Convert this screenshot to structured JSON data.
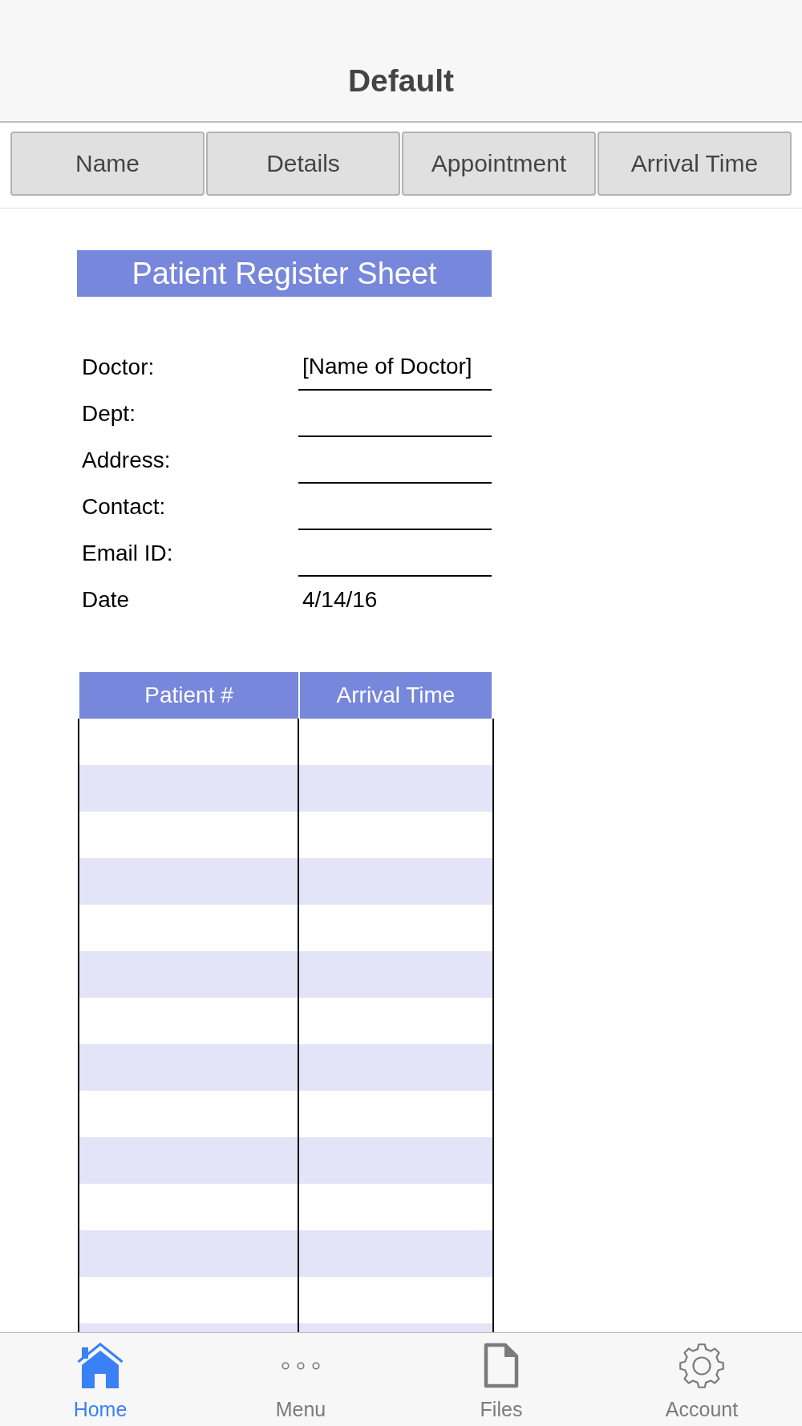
{
  "header": {
    "title": "Default"
  },
  "segments": [
    {
      "label": "Name",
      "selected": false
    },
    {
      "label": "Details",
      "selected": false
    },
    {
      "label": "Appointment",
      "selected": false
    },
    {
      "label": "Arrival Time",
      "selected": false
    }
  ],
  "sheet": {
    "title": "Patient Register Sheet",
    "fields": [
      {
        "label": "Doctor:",
        "kind": "line",
        "value": "[Name of Doctor]"
      },
      {
        "label": "Dept:",
        "kind": "line"
      },
      {
        "label": "Address:",
        "kind": "line"
      },
      {
        "label": "Contact:",
        "kind": "line"
      },
      {
        "label": "Email ID:",
        "kind": "line"
      },
      {
        "label": "Date",
        "kind": "plain",
        "value": "4/14/16"
      }
    ],
    "table": {
      "columns": [
        "Patient #",
        "Arrival Time"
      ],
      "rows": [
        {
          "shaded": false
        },
        {
          "shaded": true
        },
        {
          "shaded": false
        },
        {
          "shaded": true
        },
        {
          "shaded": false
        },
        {
          "shaded": true
        },
        {
          "shaded": false
        },
        {
          "shaded": true
        },
        {
          "shaded": false
        },
        {
          "shaded": true
        },
        {
          "shaded": false
        },
        {
          "shaded": true
        },
        {
          "shaded": false
        },
        {
          "shaded": true
        }
      ]
    }
  },
  "tab_bar": {
    "tabs": [
      {
        "label": "Home",
        "selected": true
      },
      {
        "label": "Menu",
        "selected": false
      },
      {
        "label": "Files",
        "selected": false
      },
      {
        "label": "Account",
        "selected": false
      }
    ]
  }
}
